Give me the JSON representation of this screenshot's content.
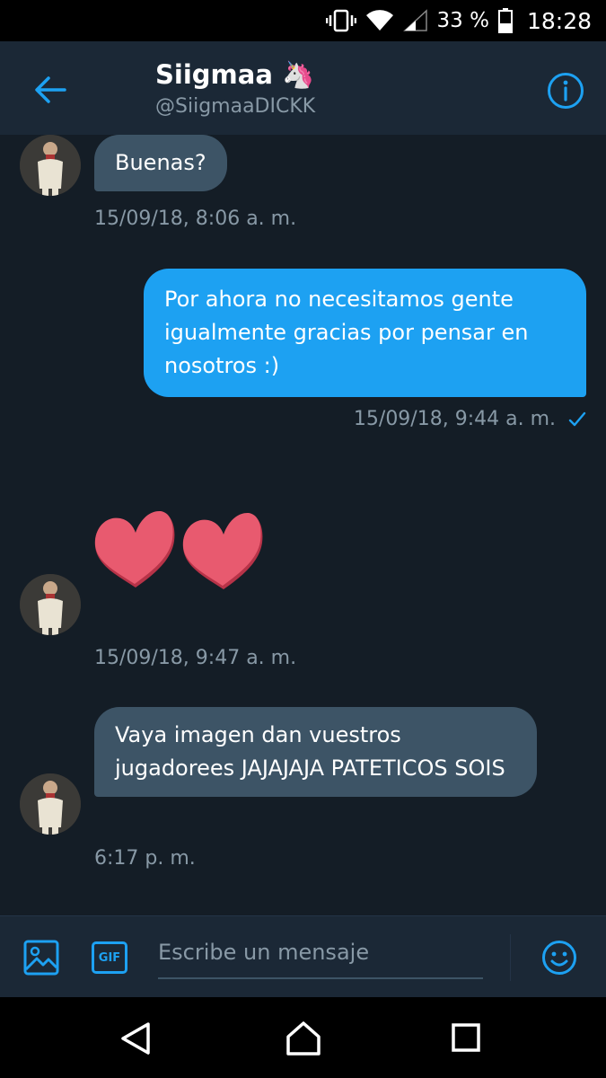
{
  "status_bar": {
    "battery": "33 %",
    "time": "18:28"
  },
  "header": {
    "name": "Siigmaa",
    "name_emoji": "🦄",
    "handle": "@SiigmaaDICKK"
  },
  "messages": [
    {
      "direction": "incoming",
      "text": "Buenas?",
      "timestamp": "15/09/18, 8:06 a. m."
    },
    {
      "direction": "outgoing",
      "text": "Por ahora no necesitamos gente igualmente gracias por pensar en nosotros :)",
      "timestamp": "15/09/18, 9:44 a. m.",
      "status_icon": "checkmark-icon"
    },
    {
      "direction": "incoming",
      "emoji": "hearts",
      "timestamp": "15/09/18, 9:47 a. m."
    },
    {
      "direction": "incoming",
      "text": "Vaya imagen dan vuestros jugadorees JAJAJAJA PATETICOS SOIS",
      "timestamp": "6:17 p. m."
    }
  ],
  "composer": {
    "placeholder": "Escribe un mensaje",
    "gif_label": "GIF"
  },
  "colors": {
    "background": "#141d26",
    "header": "#1b2836",
    "accent": "#1da1f2",
    "incoming_bubble": "#3d5466",
    "muted_text": "#8899a6",
    "heart": "#e85a6f"
  }
}
